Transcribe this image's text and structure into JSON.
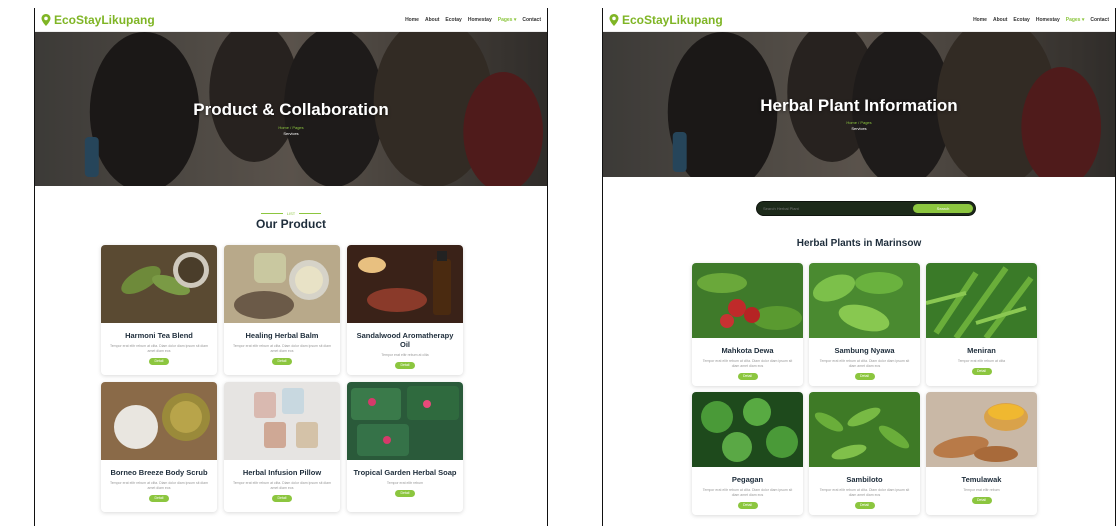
{
  "left": {
    "brand": "EcoStayLikupang",
    "nav": [
      "Home",
      "About",
      "Ecotay",
      "Homestay",
      "Pages ▾",
      "Contact"
    ],
    "nav_active": 4,
    "hero_title": "Product & Collaboration",
    "crumb": "Home / Pages",
    "crumb2": "Services",
    "kicker": "LIST",
    "section_title": "Our Product",
    "cards": [
      {
        "title": "Harmoni Tea Blend",
        "text": "Tempor erat elitr rebum at clita. Diam dolor diam ipsum sit diam amet diam eos",
        "button": "Detail"
      },
      {
        "title": "Healing Herbal Balm",
        "text": "Tempor erat elitr rebum at clita. Diam dolor diam ipsum sit diam amet diam eos",
        "button": "Detail"
      },
      {
        "title": "Sandalwood Aromatherapy Oil",
        "text": "Tempor erat elitr rebum at clita",
        "button": "Detail"
      },
      {
        "title": "Borneo Breeze Body Scrub",
        "text": "Tempor erat elitr rebum at clita. Diam dolor diam ipsum sit diam amet diam eos",
        "button": "Detail"
      },
      {
        "title": "Herbal Infusion Pillow",
        "text": "Tempor erat elitr rebum at clita. Diam dolor diam ipsum sit diam amet diam eos",
        "button": "Detail"
      },
      {
        "title": "Tropical Garden Herbal Soap",
        "text": "Tempor erat elitr rebum",
        "button": "Detail"
      }
    ]
  },
  "right": {
    "brand": "EcoStayLikupang",
    "nav": [
      "Home",
      "About",
      "Ecotay",
      "Homestay",
      "Pages ▾",
      "Contact"
    ],
    "nav_active": 4,
    "hero_title": "Herbal Plant Information",
    "crumb": "Home / Pages",
    "crumb2": "Services",
    "search_placeholder": "Search Herbal Plant",
    "search_button": "Search",
    "section_title": "Herbal Plants in Marinsow",
    "cards": [
      {
        "title": "Mahkota Dewa",
        "text": "Tempor erat elitr rebum at clita. Diam dolor diam ipsum sit diam amet diam eos",
        "button": "Detail"
      },
      {
        "title": "Sambung Nyawa",
        "text": "Tempor erat elitr rebum at clita. Diam dolor diam ipsum sit diam amet diam eos",
        "button": "Detail"
      },
      {
        "title": "Meniran",
        "text": "Tempor erat elitr rebum at clita",
        "button": "Detail"
      },
      {
        "title": "Pegagan",
        "text": "Tempor erat elitr rebum at clita. Diam dolor diam ipsum sit diam amet diam eos",
        "button": "Detail"
      },
      {
        "title": "Sambiloto",
        "text": "Tempor erat elitr rebum at clita. Diam dolor diam ipsum sit diam amet diam eos",
        "button": "Detail"
      },
      {
        "title": "Temulawak",
        "text": "Tempor erat elitr rebum",
        "button": "Detail"
      }
    ]
  },
  "colors": {
    "accent": "#8cc63f",
    "heading": "#1e2d3b",
    "brand": "#7fb525"
  }
}
